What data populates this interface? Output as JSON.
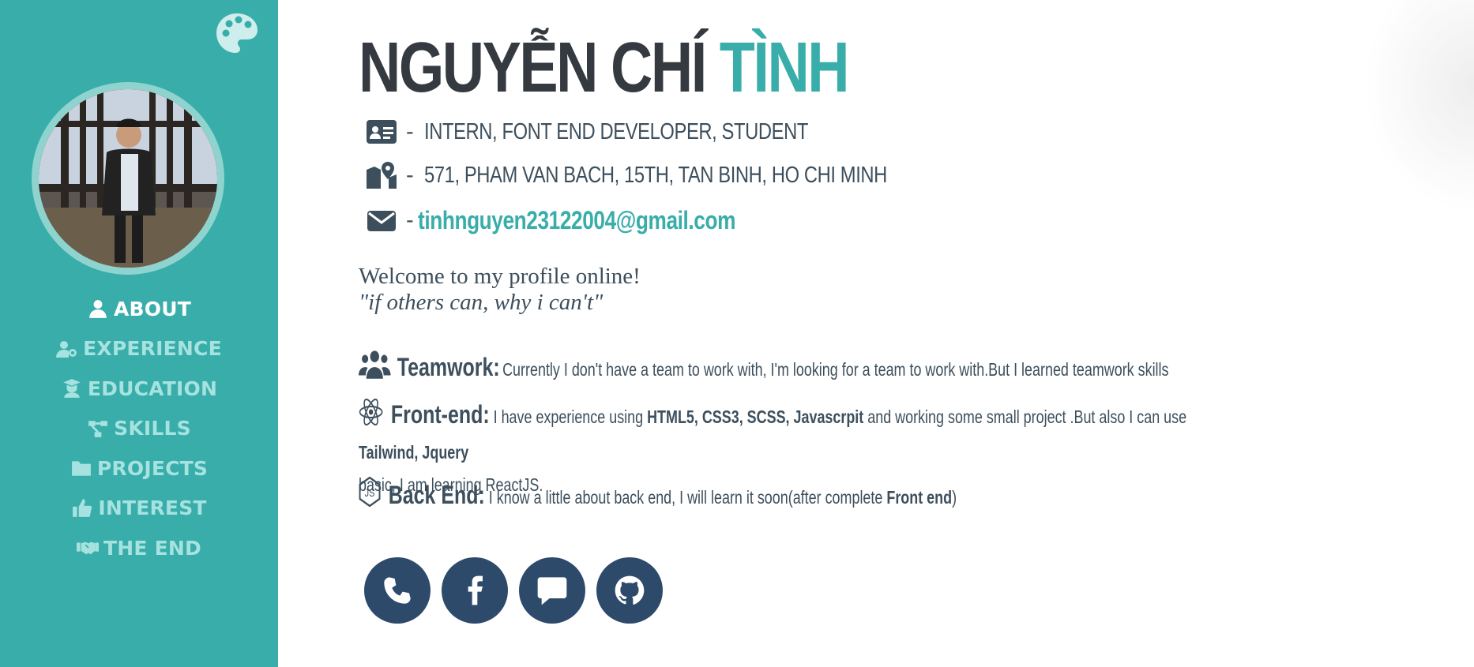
{
  "colors": {
    "accent": "#38ada9",
    "nav_inactive": "#a6e2df",
    "dark": "#343a40",
    "social_bg": "#2e4a6b"
  },
  "sidebar": {
    "theme_icon": "palette-icon",
    "nav": [
      {
        "label": "ABOUT",
        "icon": "user-icon",
        "active": true
      },
      {
        "label": "EXPERIENCE",
        "icon": "user-gear-icon",
        "active": false
      },
      {
        "label": "EDUCATION",
        "icon": "graduate-icon",
        "active": false
      },
      {
        "label": "SKILLS",
        "icon": "diagram-icon",
        "active": false
      },
      {
        "label": "PROJECTS",
        "icon": "folder-icon",
        "active": false
      },
      {
        "label": "INTEREST",
        "icon": "thumbs-up-icon",
        "active": false
      },
      {
        "label": "THE END",
        "icon": "handshake-icon",
        "active": false
      }
    ]
  },
  "header": {
    "name_first": "NGUYỄN CHÍ",
    "name_last": "TÌNH"
  },
  "info": {
    "role": "INTERN, FONT END DEVELOPER, STUDENT",
    "address": "571, PHAM VAN BACH, 15TH, TAN BINH, HO CHI MINH",
    "email": "tinhnguyen23122004@gmail.com",
    "dash": "-"
  },
  "intro": {
    "welcome": "Welcome to my profile online!",
    "quote": "\"if others can, why i can't\""
  },
  "skills": {
    "teamwork": {
      "head": "Teamwork:",
      "text": "Currently I don't have a team to work with, I'm looking for a team to work with.But I learned teamwork skills"
    },
    "frontend": {
      "head": "Front-end:",
      "t1": "I have experience using",
      "b1": "HTML5, CSS3, SCSS, Javascrpit",
      "t2": "and working some small project .But also I can use",
      "b2": "Tailwind, Jquery",
      "t3": "basic, I am learning ReactJS."
    },
    "backend": {
      "head": "Back End:",
      "t1": "I know a little about back end, I will learn it soon(after complete",
      "b1": "Front end",
      "t2": ")"
    }
  },
  "socials": [
    "phone-icon",
    "facebook-icon",
    "message-icon",
    "github-icon"
  ]
}
